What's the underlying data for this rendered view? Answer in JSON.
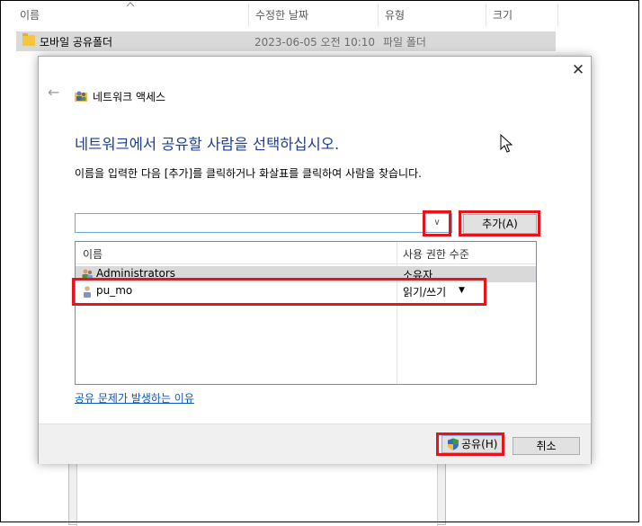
{
  "explorer": {
    "columns": [
      "이름",
      "수정한 날짜",
      "유형",
      "크기"
    ],
    "row": {
      "name": "모바일 공유폴더",
      "date": "2023-06-05 오전 10:10",
      "type": "파일 폴더"
    }
  },
  "dialog": {
    "title": "네트워크 액세스",
    "heading": "네트워크에서 공유할 사람을 선택하십시오.",
    "instruction": "이름을 입력한 다음 [추가]를 클릭하거나 화살표를 클릭하여 사람을 찾습니다.",
    "input_value": "",
    "add_button": "추가(A)",
    "list_headers": [
      "이름",
      "사용 권한 수준"
    ],
    "users": [
      {
        "name": "Administrators",
        "permission": "소유자"
      },
      {
        "name": "pu_mo",
        "permission": "읽기/쓰기"
      }
    ],
    "help_link": "공유 문제가 발생하는 이유",
    "share_button": "공유(H)",
    "cancel_button": "취소"
  },
  "colors": {
    "highlight": "#e8141c",
    "heading": "#1e3d8f",
    "link": "#0a56c4"
  }
}
